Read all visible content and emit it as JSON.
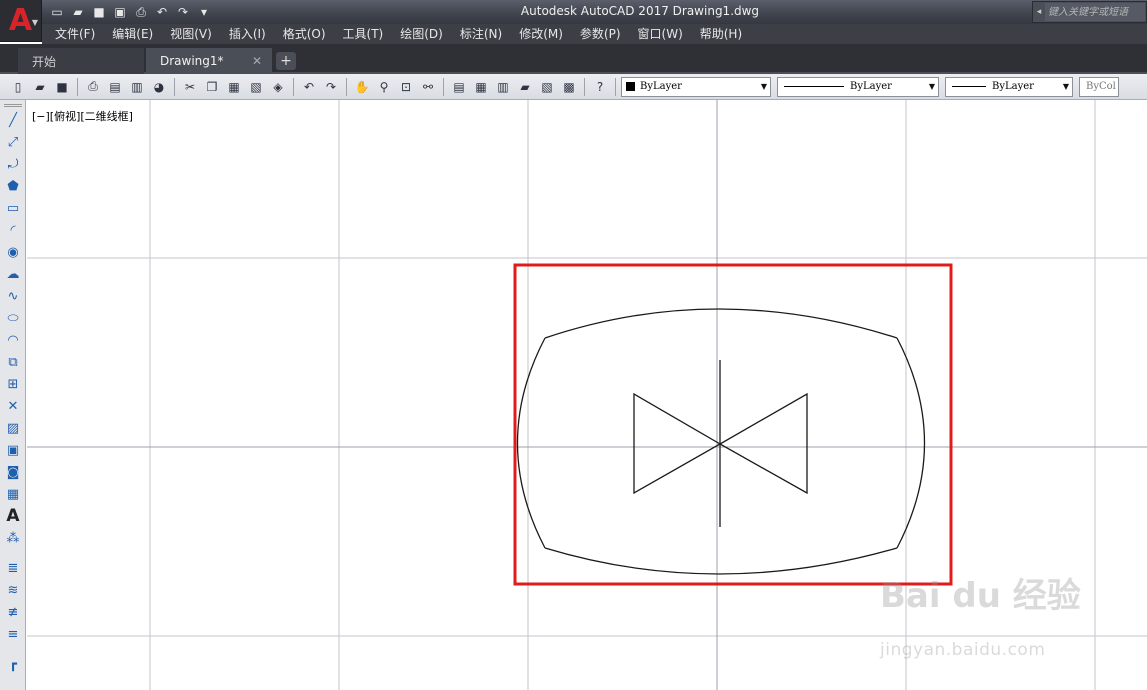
{
  "app": {
    "logo_letter": "A",
    "title": "Autodesk AutoCAD 2017    Drawing1.dwg",
    "search_placeholder": "键入关键字或短语"
  },
  "quick_access": [
    "new-icon",
    "open-icon",
    "save-icon",
    "saveas-icon",
    "plot-icon",
    "undo-icon",
    "redo-icon",
    "customize-icon"
  ],
  "menu": [
    {
      "label": "文件(F)"
    },
    {
      "label": "编辑(E)"
    },
    {
      "label": "视图(V)"
    },
    {
      "label": "插入(I)"
    },
    {
      "label": "格式(O)"
    },
    {
      "label": "工具(T)"
    },
    {
      "label": "绘图(D)"
    },
    {
      "label": "标注(N)"
    },
    {
      "label": "修改(M)"
    },
    {
      "label": "参数(P)"
    },
    {
      "label": "窗口(W)"
    },
    {
      "label": "帮助(H)"
    }
  ],
  "tabs": [
    {
      "label": "开始"
    },
    {
      "label": "Drawing1*"
    }
  ],
  "properties": {
    "color": "ByLayer",
    "linetype": "ByLayer",
    "lineweight": "ByLayer",
    "plotstyle": "ByCol"
  },
  "viewport_label": "[−][俯视][二维线框]",
  "colors": {
    "highlight": "#e01b1b",
    "grid": "#c6c6cc",
    "axis": "#9ea0ab"
  },
  "watermark": {
    "brand": "Bai du 经验",
    "url": "jingyan.baidu.com"
  }
}
